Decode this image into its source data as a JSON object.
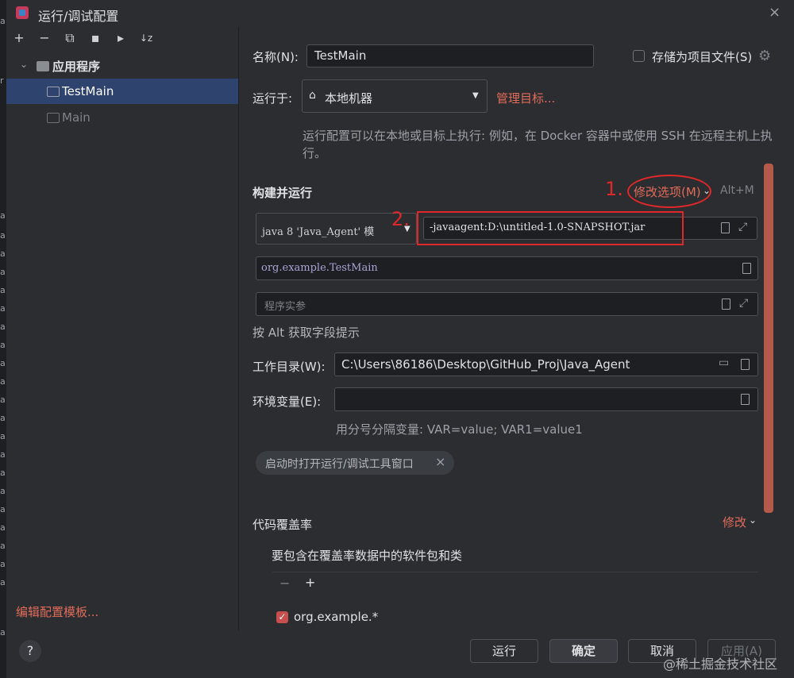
{
  "window": {
    "title": "运行/调试配置",
    "close": "×"
  },
  "left_strip_chars": [
    "a",
    "r",
    "a",
    "a",
    "a",
    "a",
    "a",
    "a",
    "a",
    "a",
    "a",
    "a",
    "a",
    "a",
    "a",
    "a",
    "a",
    "a",
    "a",
    "a",
    "a",
    "a",
    "a",
    "a"
  ],
  "toolbar": {
    "add": "+",
    "remove": "−",
    "copy": "⧉",
    "save": "▪",
    "folder": "▸",
    "sort": "↓z"
  },
  "tree": {
    "group": "应用程序",
    "items": [
      {
        "label": "TestMain"
      },
      {
        "label": "Main"
      }
    ]
  },
  "edit_templates": "编辑配置模板...",
  "help": "?",
  "form": {
    "name_label": "名称(N):",
    "name_value": "TestMain",
    "store_label": "存储为项目文件(S)",
    "run_on_label": "运行于:",
    "run_on_value": "本地机器",
    "manage_targets": "管理目标...",
    "run_on_hint": "运行配置可以在本地或目标上执行: 例如，在 Docker 容器中或使用 SSH 在远程主机上执行。",
    "build_run_title": "构建并运行",
    "modify_options": "修改选项(M)",
    "modify_shortcut": "Alt+M",
    "jdk_value": "java 8 'Java_Agent' 模",
    "vm_options": "-javaagent:D:\\untitled-1.0-SNAPSHOT.jar",
    "main_class": "org.example.TestMain",
    "program_args_placeholder": "程序实参",
    "alt_hint": "按 Alt 获取字段提示",
    "workdir_label": "工作目录(W):",
    "workdir_value": "C:\\Users\\86186\\Desktop\\GitHub_Proj\\Java_Agent",
    "env_label": "环境变量(E):",
    "env_value": "",
    "env_hint": "用分号分隔变量: VAR=value; VAR1=value1",
    "chip_label": "启动时打开运行/调试工具窗口",
    "coverage_title": "代码覆盖率",
    "coverage_modify": "修改",
    "coverage_include": "要包含在覆盖率数据中的软件包和类",
    "coverage_item": "org.example.*"
  },
  "annotations": {
    "one": "1.",
    "two": "2."
  },
  "buttons": {
    "run": "运行",
    "ok": "确定",
    "cancel": "取消",
    "apply": "应用(A)"
  },
  "watermark": "@稀土掘金技术社区"
}
